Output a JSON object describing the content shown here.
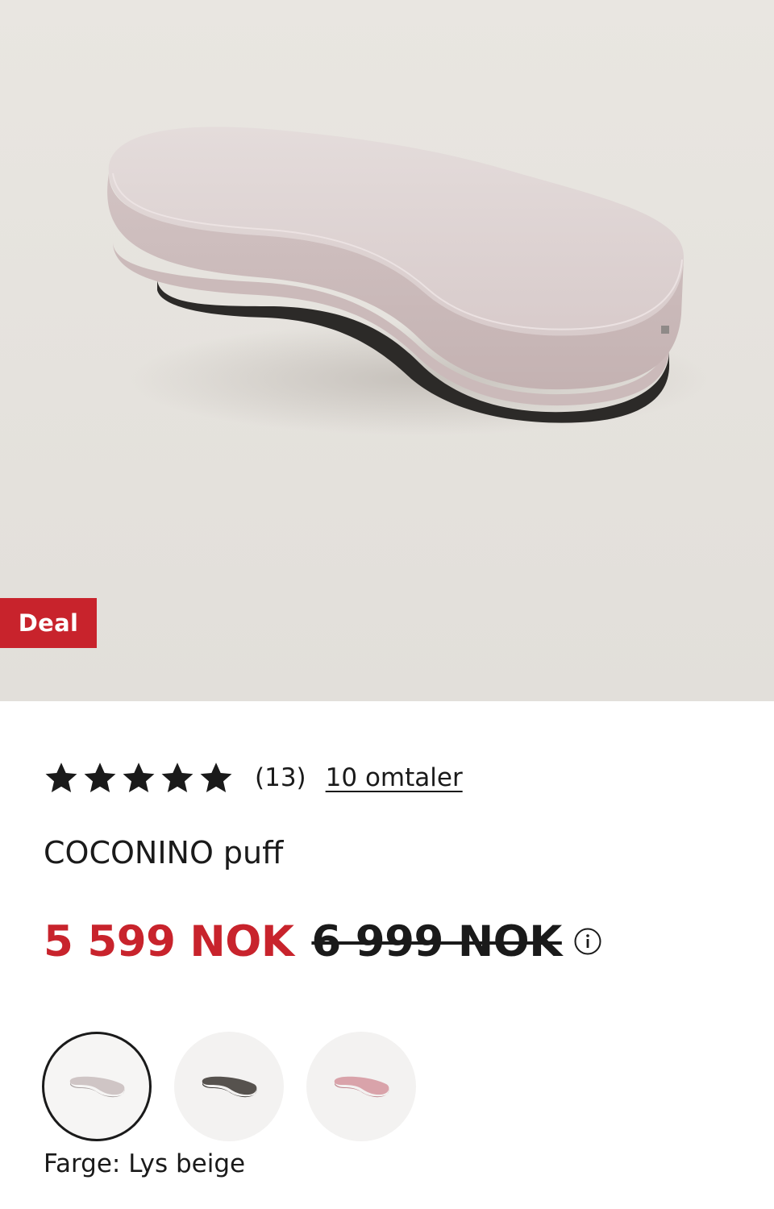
{
  "hero": {
    "image_alt": "COCONINO puff",
    "badge": "Deal",
    "badge_color": "#c8232c"
  },
  "rating": {
    "stars": 5,
    "max_stars": 5,
    "count": "(13)",
    "reviews_link": "10 omtaler"
  },
  "product": {
    "title": "COCONINO puff"
  },
  "price": {
    "current": "5 599 NOK",
    "original": "6 999 NOK",
    "current_color": "#c8232c"
  },
  "swatches": [
    {
      "name": "Lys beige",
      "color": "#cfc5c5",
      "selected": true
    },
    {
      "name": "dark grey",
      "color": "#4d4a46",
      "selected": false
    },
    {
      "name": "pink",
      "color": "#d7a1a8",
      "selected": false
    }
  ],
  "color_label": "Farge: Lys beige"
}
